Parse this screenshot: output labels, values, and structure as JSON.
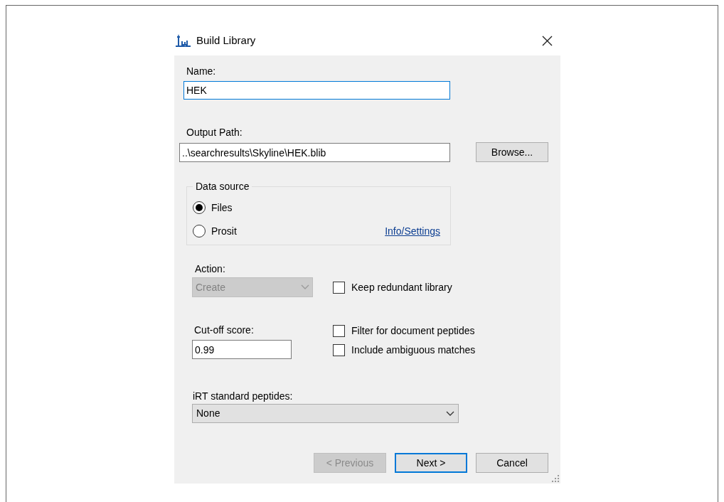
{
  "window": {
    "title": "Build Library"
  },
  "name": {
    "label": "Name:",
    "value": "HEK",
    "focused": true
  },
  "output_path": {
    "label": "Output Path:",
    "value": "..\\searchresults\\Skyline\\HEK.blib",
    "browse_button": "Browse..."
  },
  "data_source": {
    "title": "Data source",
    "options": [
      {
        "label": "Files",
        "selected": true
      },
      {
        "label": "Prosit",
        "selected": false
      }
    ],
    "link": "Info/Settings"
  },
  "action": {
    "label": "Action:",
    "value": "Create",
    "disabled": true
  },
  "keep_redundant": {
    "label": "Keep redundant library",
    "checked": false
  },
  "cutoff": {
    "label": "Cut-off score:",
    "value": "0.99"
  },
  "options": [
    {
      "label": "Filter for document peptides",
      "checked": false
    },
    {
      "label": "Include ambiguous matches",
      "checked": false
    }
  ],
  "irt": {
    "label": "iRT standard peptides:",
    "value": "None",
    "disabled": false
  },
  "buttons": [
    {
      "label": "< Previous",
      "disabled": true,
      "default": false
    },
    {
      "label": "Next >",
      "disabled": false,
      "default": true
    },
    {
      "label": "Cancel",
      "disabled": false,
      "default": false
    }
  ]
}
